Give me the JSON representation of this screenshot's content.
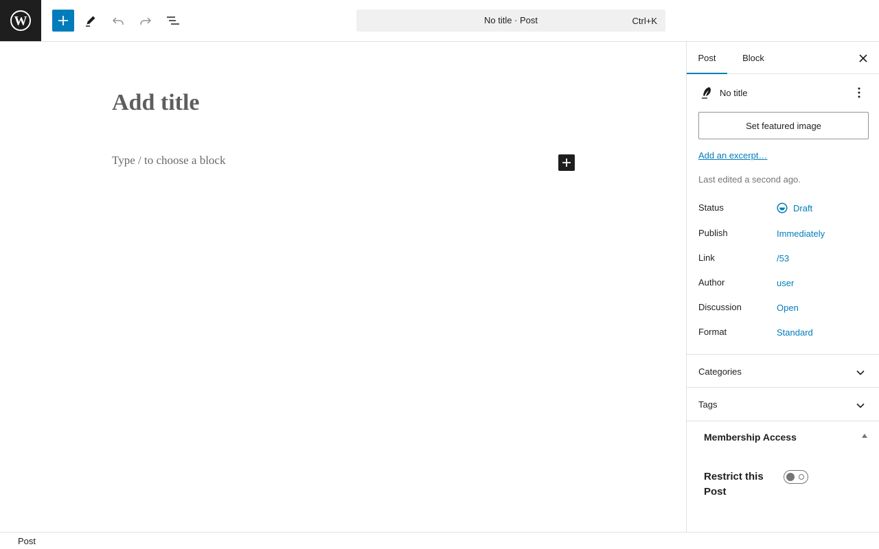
{
  "colors": {
    "accent": "#007cba",
    "dark": "#1e1e1e",
    "muted": "#757575",
    "border": "#e0e0e0"
  },
  "toolbar": {
    "logo_icon": "wordpress-logo-icon",
    "add_icon": "plus-icon",
    "tools_icon": "pencil-icon",
    "undo_icon": "undo-icon",
    "redo_icon": "redo-icon",
    "outline_icon": "list-view-icon",
    "command": {
      "title": "No title · Post",
      "shortcut": "Ctrl+K"
    }
  },
  "editor": {
    "title_placeholder": "Add title",
    "block_placeholder": "Type / to choose a block",
    "inline_add_icon": "plus-icon"
  },
  "sidebar": {
    "tabs": [
      {
        "label": "Post",
        "active": true
      },
      {
        "label": "Block",
        "active": false
      }
    ],
    "close_icon": "close-icon",
    "summary": {
      "icon": "feather-icon",
      "title": "No title",
      "menu_icon": "more-vertical-icon"
    },
    "featured_image_label": "Set featured image",
    "excerpt_link": "Add an excerpt…",
    "last_edited": "Last edited a second ago.",
    "meta": [
      {
        "label": "Status",
        "value": "Draft",
        "icon": "draft-status-icon"
      },
      {
        "label": "Publish",
        "value": "Immediately"
      },
      {
        "label": "Link",
        "value": "/53"
      },
      {
        "label": "Author",
        "value": "user"
      },
      {
        "label": "Discussion",
        "value": "Open"
      },
      {
        "label": "Format",
        "value": "Standard"
      }
    ],
    "panels": [
      {
        "title": "Categories",
        "icon": "chevron-down-icon"
      },
      {
        "title": "Tags",
        "icon": "chevron-down-icon"
      }
    ],
    "membership": {
      "title": "Membership Access",
      "caret_icon": "caret-up-icon",
      "restrict_label": "Restrict this Post",
      "restrict_enabled": false
    }
  },
  "footer": {
    "breadcrumb": "Post"
  }
}
